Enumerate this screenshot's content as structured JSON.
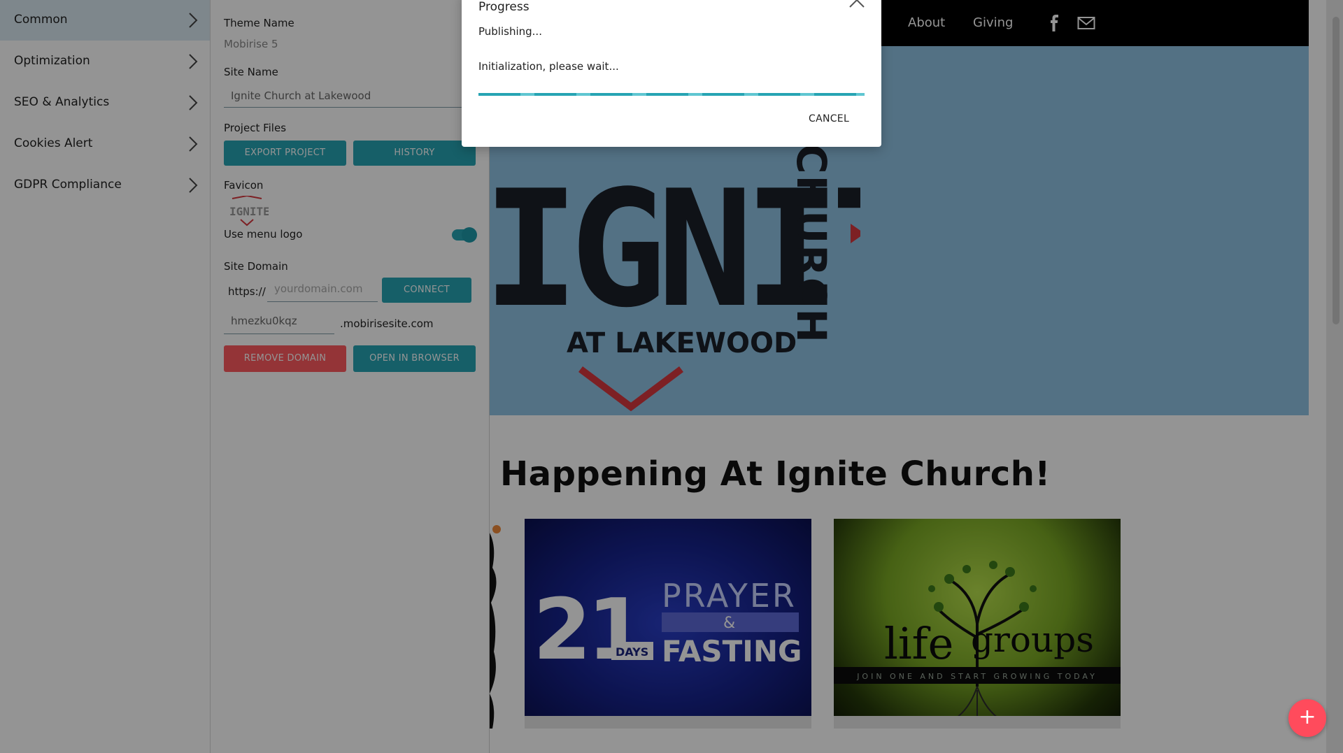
{
  "sidebar": {
    "items": [
      {
        "label": "Common"
      },
      {
        "label": "Optimization"
      },
      {
        "label": "SEO & Analytics"
      },
      {
        "label": "Cookies Alert"
      },
      {
        "label": "GDPR Compliance"
      }
    ]
  },
  "panel": {
    "theme_name_label": "Theme Name",
    "theme_name_value": "Mobirise 5",
    "site_name_label": "Site Name",
    "site_name_value": "Ignite Church at Lakewood",
    "project_files_label": "Project Files",
    "export_button": "EXPORT PROJECT",
    "history_button": "HISTORY",
    "favicon_label": "Favicon",
    "favicon_logo_text": "IGNITE",
    "use_menu_logo_label": "Use menu logo",
    "use_menu_logo_on": true,
    "site_domain_label": "Site Domain",
    "https_prefix": "https://",
    "domain_placeholder": "yourdomain.com",
    "connect_button": "CONNECT",
    "subdomain_value": "hmezku0kqz",
    "subdomain_suffix": ".mobirisesite.com",
    "remove_domain_button": "REMOVE DOMAIN",
    "open_browser_button": "OPEN IN BROWSER"
  },
  "site": {
    "nav": {
      "about": "About",
      "giving": "Giving"
    },
    "logo": {
      "word": "IGNITE",
      "church": "CHURCH",
      "place": "AT LAKEWOOD"
    },
    "section_title": "Happening At Ignite Church!",
    "cards": {
      "prayer": {
        "num": "21",
        "days": "DAYS",
        "prayer": "PRAYER",
        "amp": "&",
        "fasting": "FASTING"
      },
      "life": {
        "title_a": "life",
        "title_b": "groups",
        "tagline": "JOIN ONE AND START GROWING TODAY"
      }
    }
  },
  "dialog": {
    "title": "Progress",
    "status": "Publishing...",
    "detail": "Initialization, please wait...",
    "progress": 1.0,
    "cancel": "CANCEL"
  },
  "fab": {
    "label": "+"
  },
  "colors": {
    "accent": "#27a4b3",
    "danger": "#ff5a5f",
    "fab": "#ff4b5c",
    "hero": "#8fc3e4",
    "nav": "#000000"
  }
}
